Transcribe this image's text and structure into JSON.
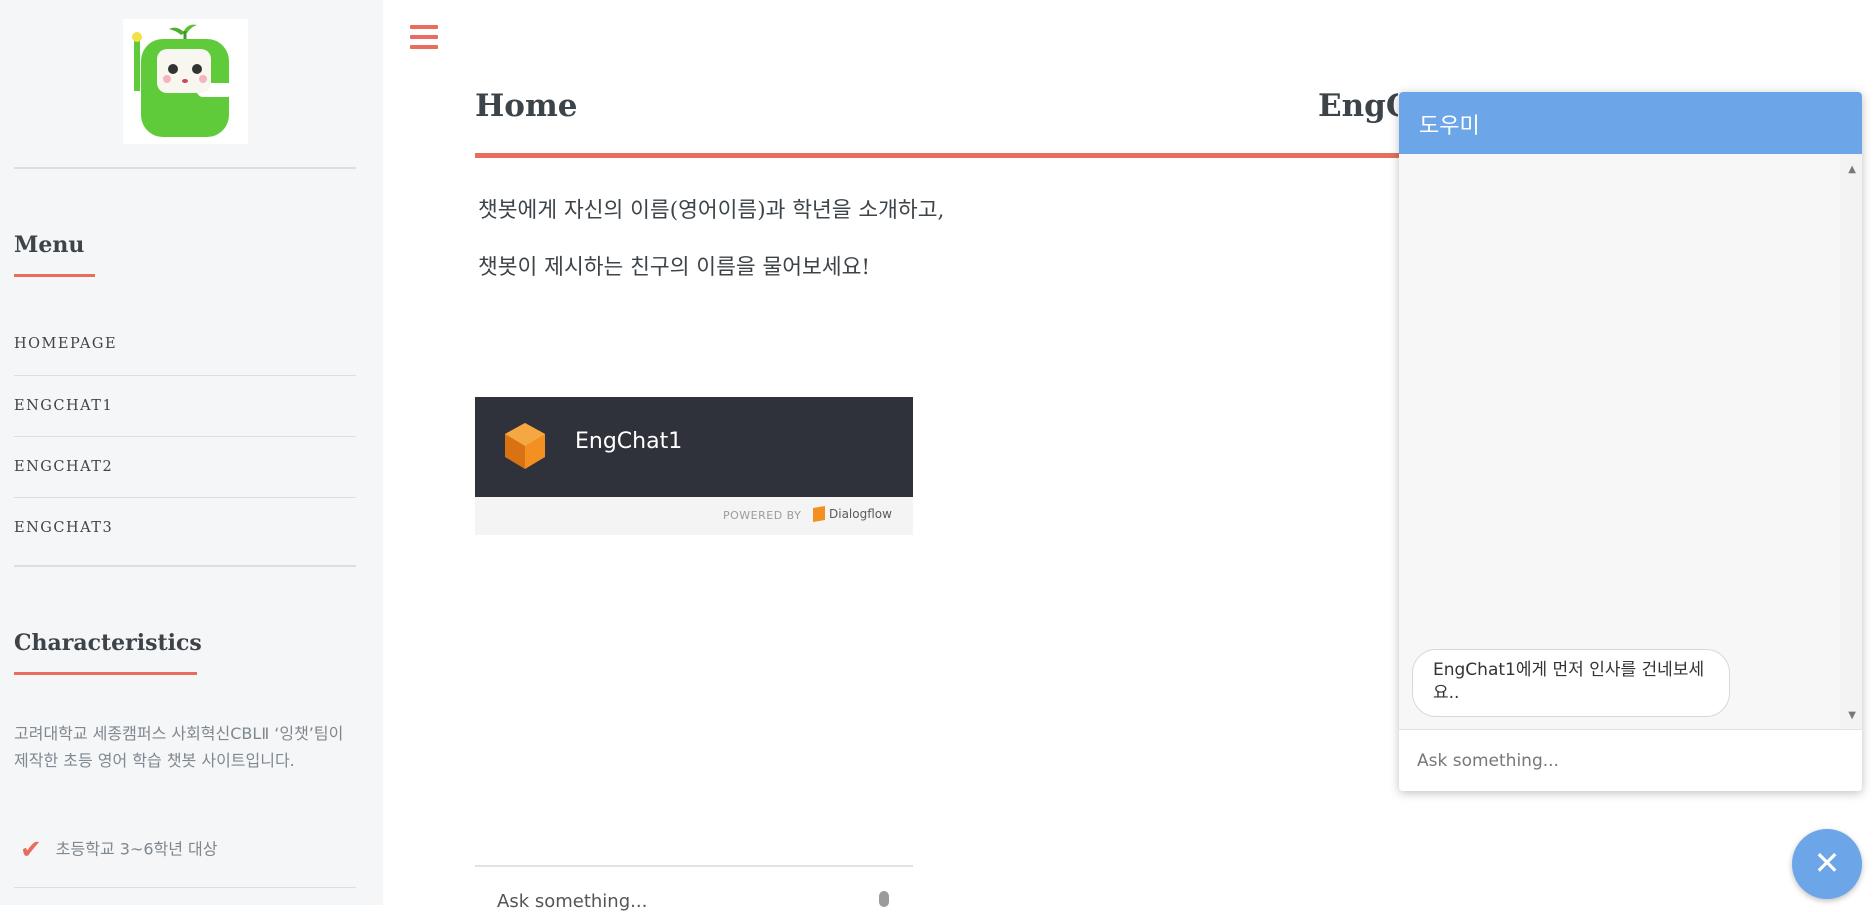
{
  "sidebar": {
    "menu_heading": "Menu",
    "menu_items": [
      {
        "label": "HOMEPAGE"
      },
      {
        "label": "ENGCHAT1"
      },
      {
        "label": "ENGCHAT2"
      },
      {
        "label": "ENGCHAT3"
      }
    ],
    "characteristics_heading": "Characteristics",
    "description": "고려대학교 세종캠퍼스 사회혁신CBLⅡ ‘잉챗’팀이 제작한 초등 영어 학습 챗봇 사이트입니다.",
    "check_item": "초등학교 3~6학년 대상"
  },
  "main": {
    "title": "Home",
    "site_title": "EngC",
    "paragraphs": [
      "챗봇에게 자신의 이름(영어이름)과 학년을 소개하고,",
      "챗봇이 제시하는 친구의 이름을 물어보세요!"
    ]
  },
  "embed": {
    "agent_name": "EngChat1",
    "powered_by": "POWERED BY",
    "brand": "Dialogflow",
    "input_placeholder": "Ask something..."
  },
  "chat": {
    "header_title": "도우미",
    "bot_message": "EngChat1에게 먼저 인사를 건네보세요..",
    "input_placeholder": "Ask something...",
    "close_symbol": "✕"
  },
  "colors": {
    "accent": "#e86d5e",
    "chat_blue": "#6ca6e8",
    "embed_dark": "#2f323a"
  }
}
